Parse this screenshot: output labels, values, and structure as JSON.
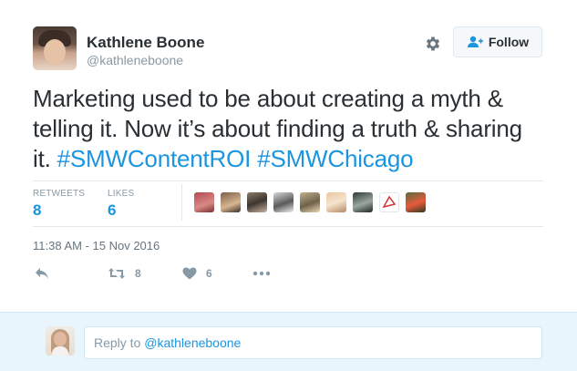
{
  "author": {
    "name": "Kathlene Boone",
    "handle": "@kathleneboone"
  },
  "header": {
    "follow_label": "Follow",
    "settings_icon": "gear-icon",
    "follow_icon": "add-user-icon"
  },
  "tweet": {
    "text_plain": "Marketing used to be about creating a myth & telling it. Now it’s about finding a truth & sharing it.",
    "hashtags": [
      "#SMWContentROI",
      "#SMWChicago"
    ]
  },
  "stats": {
    "retweets_label": "RETWEETS",
    "retweets_count": "8",
    "likes_label": "LIKES",
    "likes_count": "6",
    "liker_avatars": 9
  },
  "timestamp": "11:38 AM - 15 Nov 2016",
  "actions": {
    "reply_icon": "reply-icon",
    "retweet_icon": "retweet-icon",
    "retweet_count": "8",
    "like_icon": "heart-icon",
    "like_count": "6",
    "more_icon": "more-dots-icon"
  },
  "reply": {
    "prefix": "Reply to ",
    "mention": "@kathleneboone"
  },
  "colors": {
    "link": "#1b95e0",
    "muted": "#8899a6",
    "text": "#292f33",
    "reply_bg": "#e8f5fd"
  }
}
